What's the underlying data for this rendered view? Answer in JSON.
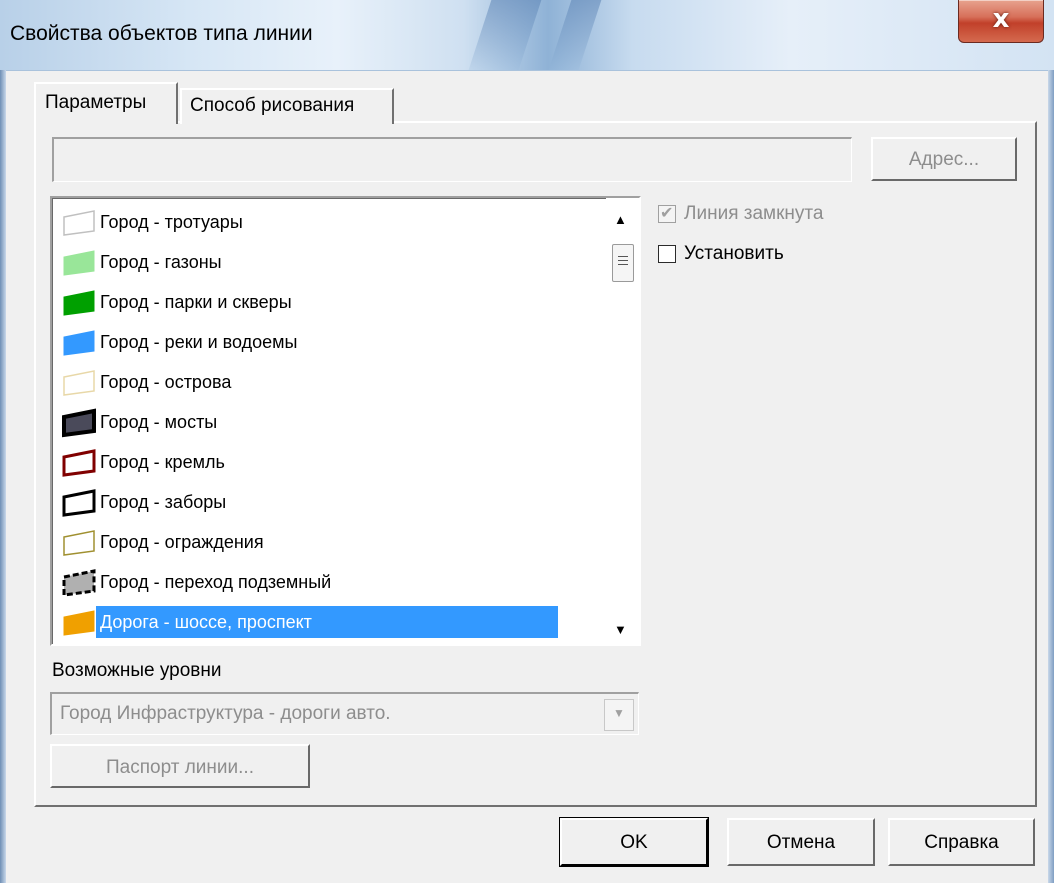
{
  "window": {
    "title": "Свойства объектов типа линии",
    "close_label": "x"
  },
  "tabs": [
    {
      "label": "Параметры",
      "active": true
    },
    {
      "label": "Способ рисования",
      "active": false
    }
  ],
  "address": {
    "value": "",
    "button_label": "Адрес..."
  },
  "list": {
    "items": [
      {
        "label": "Город - тротуары",
        "icon": "outline-parallelogram-icon",
        "color": "#c0c0c0",
        "selected": false
      },
      {
        "label": "Город - газоны",
        "icon": "filled-parallelogram-icon",
        "color": "#99e699",
        "selected": false
      },
      {
        "label": "Город - парки и скверы",
        "icon": "filled-parallelogram-icon",
        "color": "#00a000",
        "selected": false
      },
      {
        "label": "Город - реки и водоемы",
        "icon": "filled-parallelogram-icon",
        "color": "#3399ff",
        "selected": false
      },
      {
        "label": "Город - острова",
        "icon": "outline-parallelogram-icon",
        "color": "#e8d8a8",
        "selected": false
      },
      {
        "label": "Город - мосты",
        "icon": "bordered-parallelogram-icon",
        "color": "#4a4a5a",
        "selected": false
      },
      {
        "label": "Город - кремль",
        "icon": "outline-parallelogram-icon",
        "color": "#800000",
        "selected": false
      },
      {
        "label": "Город - заборы",
        "icon": "outline-parallelogram-icon",
        "color": "#000000",
        "selected": false
      },
      {
        "label": "Город - ограждения",
        "icon": "outline-parallelogram-icon",
        "color": "#a09030",
        "selected": false
      },
      {
        "label": "Город - переход подземный",
        "icon": "dashed-parallelogram-icon",
        "color": "#808080",
        "selected": false
      },
      {
        "label": "Дорога - шоссе, проспект",
        "icon": "filled-parallelogram-icon",
        "color": "#f0a000",
        "selected": true
      }
    ]
  },
  "checkboxes": {
    "closed": {
      "label": "Линия замкнута",
      "checked": true,
      "disabled": true
    },
    "set": {
      "label": "Установить",
      "checked": false,
      "disabled": false
    }
  },
  "levels": {
    "label": "Возможные уровни",
    "value": "Город Инфраструктура - дороги авто."
  },
  "passport_button": "Паспорт линии...",
  "buttons": {
    "ok": "OK",
    "cancel": "Отмена",
    "help": "Справка"
  }
}
